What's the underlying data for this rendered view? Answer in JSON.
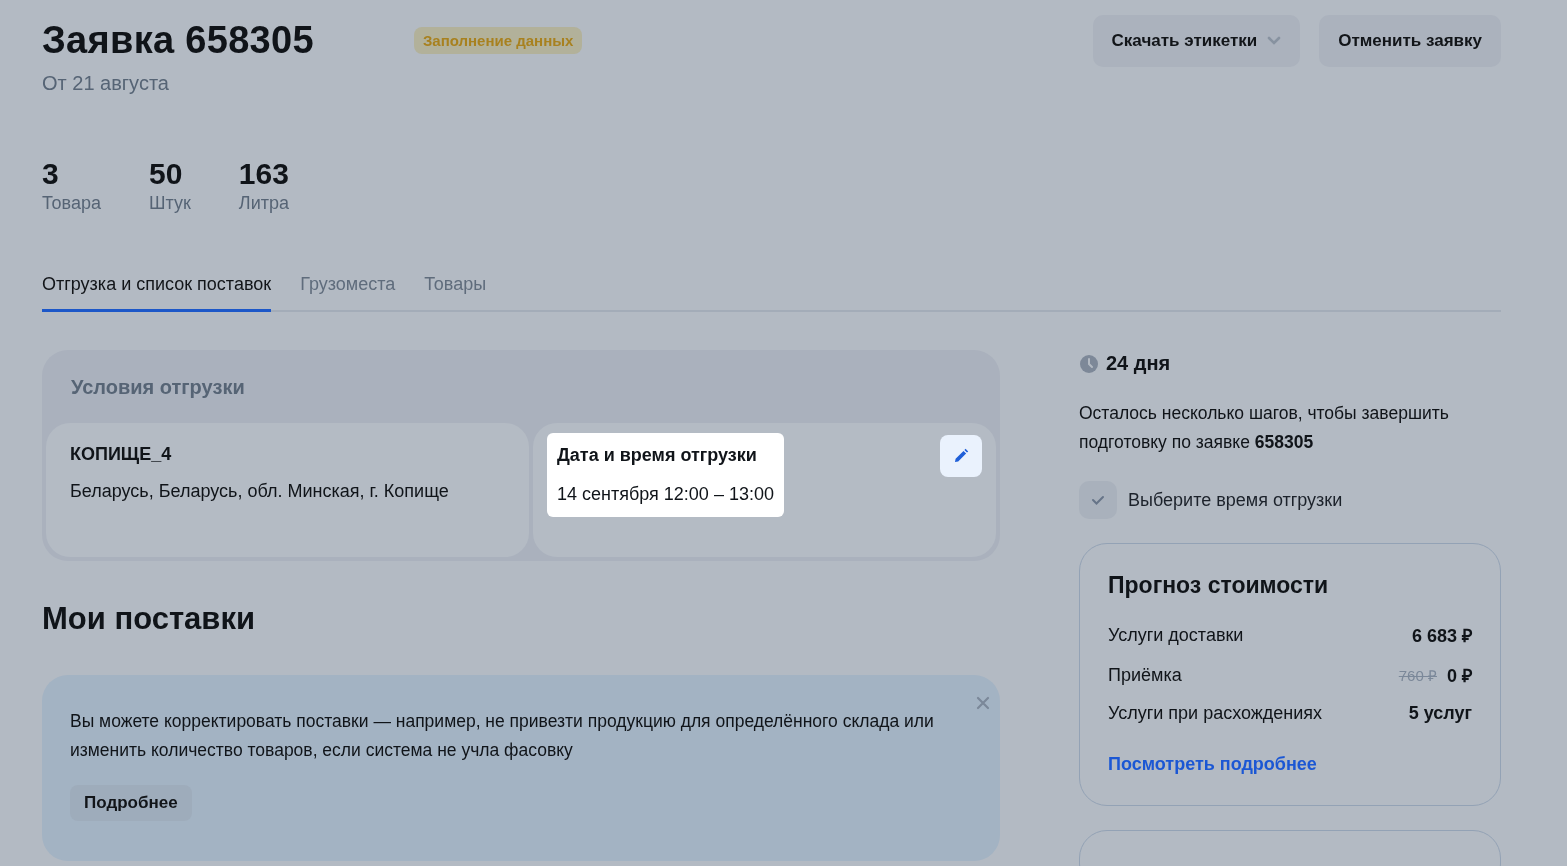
{
  "header": {
    "title": "Заявка 658305",
    "status": "Заполнение данных",
    "subtitle": "От 21 августа",
    "actions": [
      {
        "label": "Скачать этикетки",
        "kind": "dropdown"
      },
      {
        "label": "Отменить заявку",
        "kind": "plain"
      }
    ]
  },
  "stats": [
    {
      "value": "3",
      "label": "Товара"
    },
    {
      "value": "50",
      "label": "Штук"
    },
    {
      "value": "163",
      "label": "Литра"
    }
  ],
  "tabs": [
    {
      "label": "Отгрузка и список поставок",
      "selected": true
    },
    {
      "label": "Грузоместа",
      "selected": false
    },
    {
      "label": "Товары",
      "selected": false
    }
  ],
  "shipping_conditions": {
    "title": "Условия отгрузки",
    "warehouse": {
      "name": "КОПИЩЕ_4",
      "address": "Беларусь, Беларусь, обл. Минская, г. Копище"
    },
    "datetime": {
      "label": "Дата и время отгрузки",
      "value": "14 сентября 12:00 – 13:00",
      "highlighted": true
    }
  },
  "my_supplies": {
    "title": "Мои поставки",
    "notice": {
      "text": "Вы можете корректировать поставки — например, не привезти продукцию для определённого склада или изменить количество товаров, если система не учла фасовку",
      "button": "Подробнее"
    }
  },
  "sidebar": {
    "days_left": "24 дня",
    "message": "Осталось несколько шагов, чтобы завершить подготовку по заявке **658305**",
    "steps": [
      {
        "label": "Выберите время отгрузки",
        "checked": true
      }
    ],
    "cost_forecast": {
      "title": "Прогноз стоимости",
      "rows": [
        {
          "label": "Услуги доставки",
          "value": "6 683 ₽"
        },
        {
          "label": "Приёмка",
          "old_value": "760 ₽",
          "value": "0 ₽"
        },
        {
          "label": "Услуги при расхождениях",
          "value": "5 услуг"
        }
      ],
      "link": "Посмотреть подробнее"
    }
  }
}
